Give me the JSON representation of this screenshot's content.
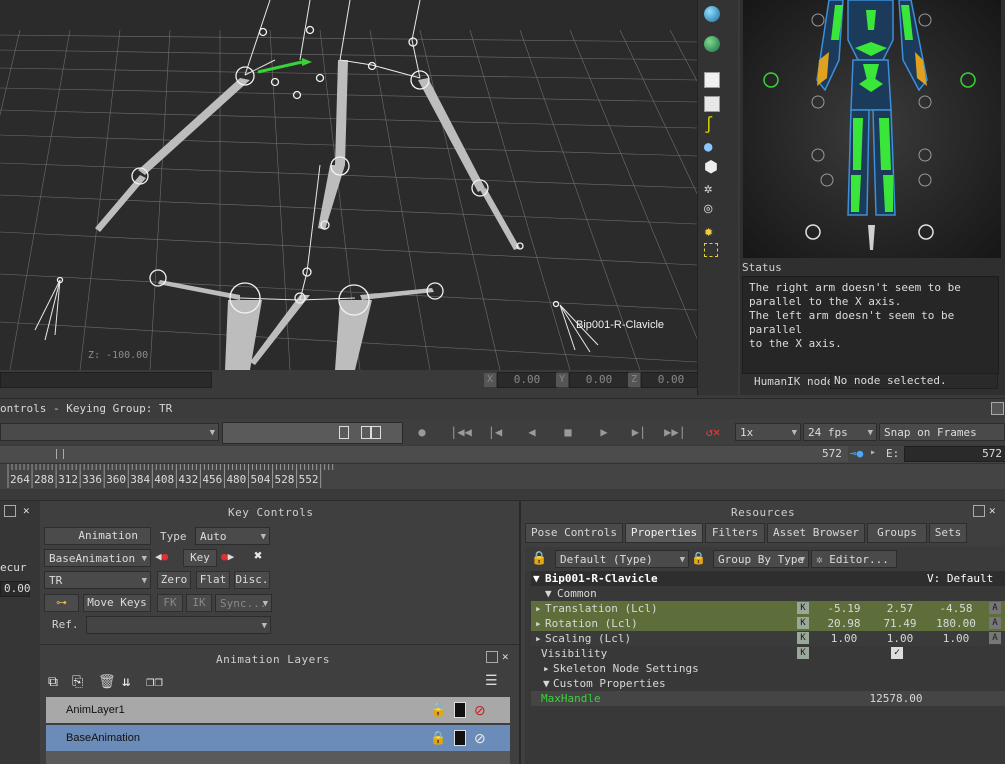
{
  "viewport": {
    "bone_label": "Bip001-R-Clavicle",
    "grid_labels": [
      "Z: -100.00"
    ],
    "coords": {
      "x_label": "X",
      "x_value": "0.00",
      "y_label": "Y",
      "y_value": "0.00",
      "z_label": "Z",
      "z_value": "0.00"
    }
  },
  "toolstrip": {
    "icons": [
      "globe-icon",
      "globe-add-icon",
      "cube-icon",
      "cube-white-icon",
      "curve-icon",
      "light-icon",
      "hexagon-icon",
      "skeleton-icon",
      "camera-icon",
      "sun-icon",
      "box-select-icon"
    ]
  },
  "humanik": {
    "status_title": "Status",
    "status_text": "The right arm doesn't seem to be\nparallel to the X axis.\nThe left arm doesn't seem to be parallel\nto the X axis.",
    "node_label": "HumanIK node",
    "node_value": "No node selected."
  },
  "transport": {
    "title": "ontrols  -  Keying Group: TR",
    "speed": "1x",
    "fps": "24 fps",
    "snap": "Snap on Frames",
    "current_frame": "572",
    "end_label": "E:",
    "end_frame": "572",
    "ticks": [
      "264",
      "288",
      "312",
      "336",
      "360",
      "384",
      "408",
      "432",
      "456",
      "480",
      "504",
      "528",
      "552"
    ]
  },
  "key_controls": {
    "title": "Key Controls",
    "animation_label": "Animation",
    "type_label": "Type",
    "type_value": "Auto",
    "take_value": "BaseAnimation",
    "key_label": "Key",
    "keying_group": "TR",
    "zero_label": "Zero",
    "flat_label": "Flat",
    "disc_label": "Disc.",
    "move_keys": "Move Keys",
    "fk_label": "FK",
    "ik_label": "IK",
    "sync_label": "Sync...",
    "ref_label": "Ref.",
    "left_partial": [
      "ecur",
      "0.00"
    ]
  },
  "anim_layers": {
    "title": "Animation Layers",
    "layers": [
      {
        "name": "AnimLayer1",
        "selected": false
      },
      {
        "name": "BaseAnimation",
        "selected": true
      }
    ]
  },
  "resources": {
    "title": "Resources",
    "tabs": [
      "Pose Controls",
      "Properties",
      "Filters",
      "Asset Browser",
      "Groups",
      "Sets"
    ],
    "active_tab": "Properties",
    "filter_value": "Default (Type)",
    "group_by": "Group By Type",
    "editor": "Editor...",
    "object_name": "Bip001-R-Clavicle",
    "view_label": "V: Default",
    "common": "Common",
    "properties": [
      {
        "name": "Translation (Lcl)",
        "k": "K",
        "v1": "-5.19",
        "v2": "2.57",
        "v3": "-4.58",
        "a": "A"
      },
      {
        "name": "Rotation (Lcl)",
        "k": "K",
        "v1": "20.98",
        "v2": "71.49",
        "v3": "180.00",
        "a": "A"
      },
      {
        "name": "Scaling (Lcl)",
        "k": "K",
        "v1": "1.00",
        "v2": "1.00",
        "v3": "1.00",
        "a": "A"
      }
    ],
    "visibility": "Visibility",
    "skeleton_settings": "Skeleton Node Settings",
    "custom_props": "Custom Properties",
    "max_handle_label": "MaxHandle",
    "max_handle_value": "12578.00"
  },
  "colors": {
    "accent_green": "#7fd13b",
    "ik_green": "#39e639",
    "ik_orange": "#e0a020",
    "layer_selected": "#6b8cb8",
    "prop_highlight": "#5e6e3a"
  }
}
